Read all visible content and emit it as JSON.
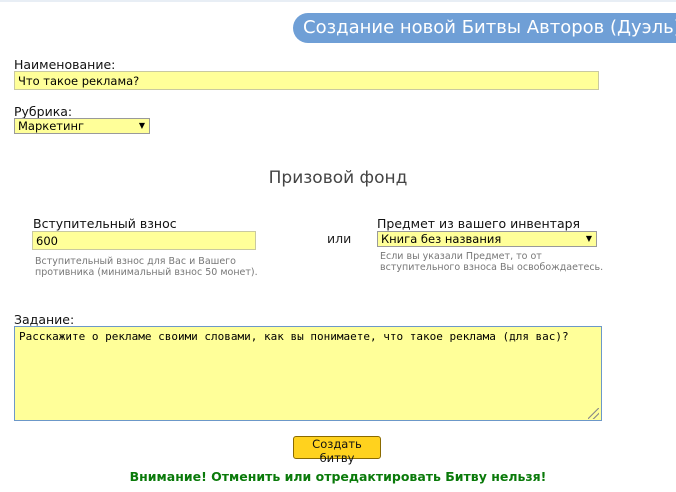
{
  "header": {
    "title": "Создание новой Битвы Авторов (Дуэль)"
  },
  "form": {
    "name_label": "Наименование:",
    "name_value": "Что такое реклама?",
    "rubric_label": "Рубрика:",
    "rubric_value": "Маркетинг",
    "prize_title": "Призовой фонд",
    "fee_label": "Вступительный взнос",
    "fee_value": "600",
    "fee_hint": "Вступительный взнос для Вас и Вашего противника (минимальный взнос 50 монет).",
    "or_label": "или",
    "item_label": "Предмет из вашего инвентаря",
    "item_value": "Книга без названия",
    "item_hint": "Если вы указали Предмет, то от вступительного взноса Вы освобождаетесь.",
    "task_label": "Задание:",
    "task_value": "Расскажите о рекламе своими словами, как вы понимаете, что такое реклама (для вас)?",
    "submit_label": "Создать битву",
    "warning": "Внимание! Отменить или отредактировать Битву нельзя!"
  },
  "icons": {
    "dropdown": "chevron-down-icon",
    "resize": "resize-grip-icon"
  },
  "colors": {
    "header_bg": "#6f9fd6",
    "field_bg": "#ffff99",
    "button_bg": "#ffd21e",
    "warning": "#0a7a0a"
  }
}
